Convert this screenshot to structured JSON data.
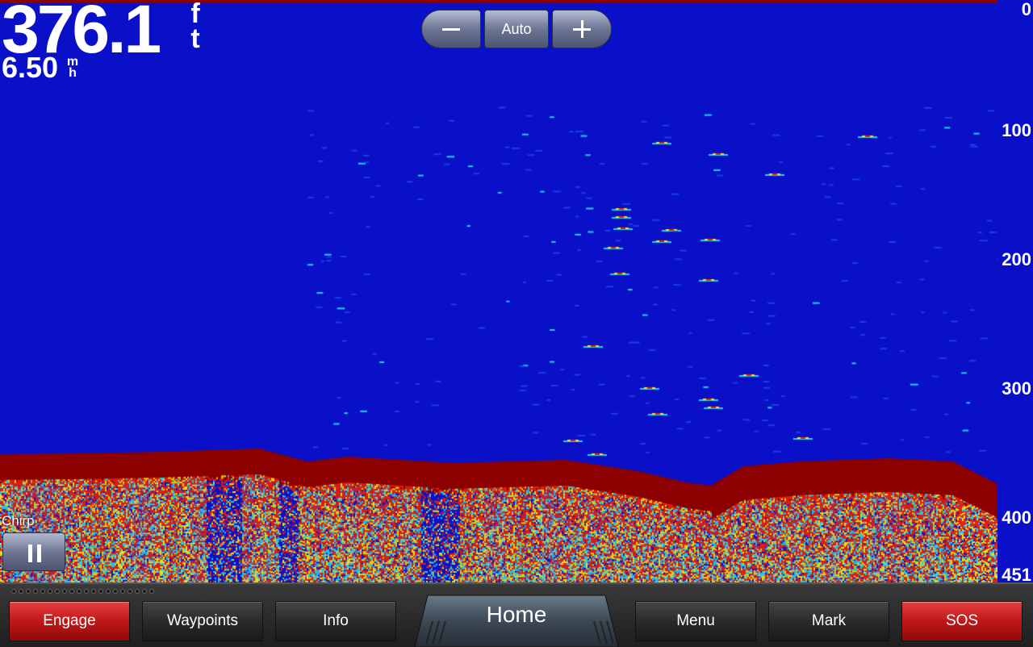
{
  "readouts": {
    "depth_value": "376.1",
    "depth_unit_top": "f",
    "depth_unit_bottom": "t",
    "speed_value": "6.50",
    "speed_unit_top": "m",
    "speed_unit_bottom": "h"
  },
  "zoom": {
    "minus_icon": "minus-icon",
    "auto_label": "Auto",
    "plus_icon": "plus-icon"
  },
  "depth_scale": {
    "ticks": [
      "0",
      "100",
      "200",
      "300",
      "400",
      "451"
    ],
    "max": 451
  },
  "sonar": {
    "mode_label": "Chirp",
    "pause_icon": "pause-icon",
    "colors": {
      "water": "#0a10c8",
      "bottom": "#8c0000",
      "strong": "#e02010",
      "medium": "#f0e010",
      "weak": "#20d0f0"
    }
  },
  "bottom_bar": {
    "buttons": [
      {
        "label": "Engage",
        "style": "red"
      },
      {
        "label": "Waypoints",
        "style": "dark"
      },
      {
        "label": "Info",
        "style": "dark"
      },
      {
        "label": "Menu",
        "style": "dark"
      },
      {
        "label": "Mark",
        "style": "dark"
      },
      {
        "label": "SOS",
        "style": "red"
      }
    ],
    "home_label": "Home"
  }
}
